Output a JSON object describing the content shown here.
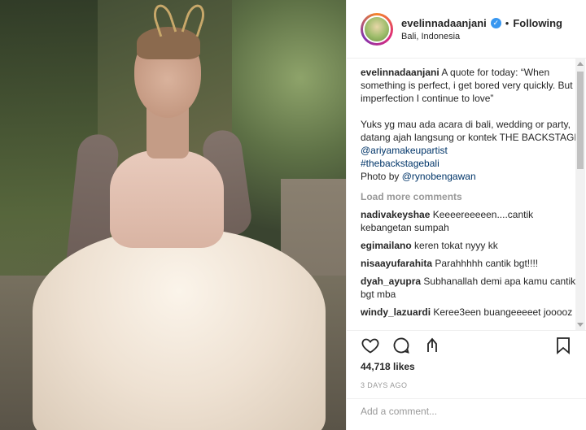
{
  "header": {
    "username": "evelinnadaanjani",
    "verified_glyph": "✓",
    "separator": "•",
    "follow_label": "Following",
    "location": "Bali, Indonesia"
  },
  "caption": {
    "username": "evelinnadaanjani",
    "line1": "A quote for today: “When something is perfect, i get bored very quickly. But imperfection I continue to love”",
    "line2_text": "Yuks yg mau ada acara di bali, wedding or party, datang ajah langsung or kontek THE BACKSTAGE ",
    "line2_mention": "@ariyamakeupartist",
    "hashtag": "#thebackstagebali",
    "photo_by_text": "Photo by ",
    "photo_by_mention": "@rynobengawan"
  },
  "load_more_label": "Load more comments",
  "comments": [
    {
      "user": "nadivakeyshae",
      "text": "Keeeereeeeen....cantik kebangetan sumpah"
    },
    {
      "user": "egimailano",
      "text": "keren tokat nyyy kk"
    },
    {
      "user": "nisaayufarahita",
      "text": "Parahhhhh cantik bgt!!!!"
    },
    {
      "user": "dyah_ayupra",
      "text": "Subhanallah demi apa kamu cantik bgt mba"
    },
    {
      "user": "windy_lazuardi",
      "text": "Keree3een buangeeeeet jooooz"
    }
  ],
  "icons": {
    "like": "heart-icon",
    "comment": "comment-icon",
    "share": "share-icon",
    "save": "bookmark-icon"
  },
  "likes": "44,718 likes",
  "date": "3 DAYS AGO",
  "add_comment_placeholder": "Add a comment..."
}
